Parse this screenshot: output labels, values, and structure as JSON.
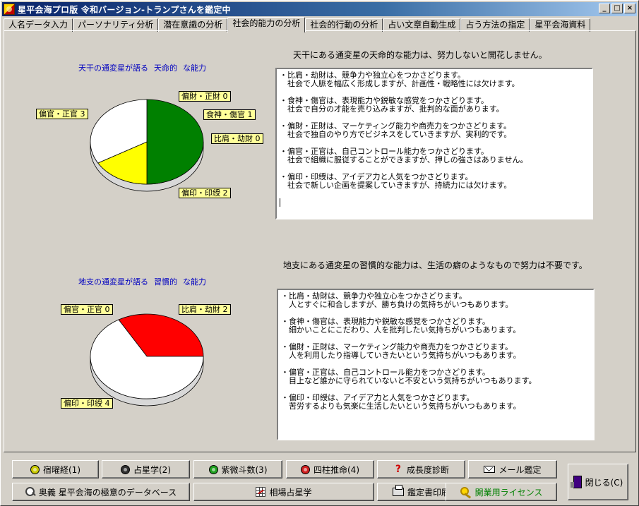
{
  "window": {
    "title": "星平会海プロ版 令和バージョン-トランプさんを鑑定中",
    "controls": {
      "minimize": "_",
      "maximize": "□",
      "close": "×"
    }
  },
  "tabs": [
    {
      "label": "人名データ入力"
    },
    {
      "label": "パーソナリティ分析"
    },
    {
      "label": "潜在意識の分析"
    },
    {
      "label": "社会的能力の分析",
      "active": true
    },
    {
      "label": "社会的行動の分析"
    },
    {
      "label": "占い文章自動生成"
    },
    {
      "label": "占う方法の指定"
    },
    {
      "label": "星平会海資料"
    }
  ],
  "top_section": {
    "heading": "天干にある通変星の天命的な能力は、努力しないと開花しません。",
    "chart_title": [
      "天干の通変星が語る",
      "天命的",
      "な能力"
    ],
    "pie_labels": {
      "henkan_seikan": "偏官・正官 3",
      "hensai_seizai": "偏財・正財 0",
      "shokujin_shokan": "食神・傷官 1",
      "hiken_kouzai": "比肩・劫財 0",
      "henin_inju": "偏印・印綬 2"
    },
    "text_lines": [
      [
        "・比肩・劫財は、競争力や独立心をつかさどります。",
        "　社会で人脈を幅広く形成しますが、計画性・戦略性には欠けます。"
      ],
      [
        "・食神・傷官は、表現能力や鋭敏な感覚をつかさどります。",
        "　社会で自分の才能を売り込みますが、批判的な面があります。"
      ],
      [
        "・偏財・正財は、マーケティング能力や商売力をつかさどります。",
        "　社会で独自のやり方でビジネスをしていきますが、実利的です。"
      ],
      [
        "・偏官・正官は、自己コントロール能力をつかさどります。",
        "　社会で組織に服従することができますが、押しの強さはありません。"
      ],
      [
        "・偏印・印綬は、アイデア力と人気をつかさどります。",
        "　社会で新しい企画を提案していきますが、持続力には欠けます。"
      ]
    ]
  },
  "bottom_section": {
    "heading": "地支にある通変星の習慣的な能力は、生活の癖のようなもので努力は不要です。",
    "chart_title": [
      "地支の通変星が語る",
      "習慣的",
      "な能力"
    ],
    "pie_labels": {
      "henkan_seikan": "偏官・正官 0",
      "hiken_kouzai": "比肩・劫財 2",
      "henin_inju": "偏印・印綬 4"
    },
    "text_lines": [
      [
        "・比肩・劫財は、競争力や独立心をつかさどります。",
        "　人とすぐに和合しますが、勝ち負けの気持ちがいつもあります。"
      ],
      [
        "・食神・傷官は、表現能力や鋭敏な感覚をつかさどります。",
        "　細かいことにこだわり、人を批判したい気持ちがいつもあります。"
      ],
      [
        "・偏財・正財は、マーケティング能力や商売力をつかさどります。",
        "　人を利用したり指導していきたいという気持ちがいつもあります。"
      ],
      [
        "・偏官・正官は、自己コントロール能力をつかさどります。",
        "　目上など誰かに守られていないと不安という気持ちがいつもあります。"
      ],
      [
        "・偏印・印綬は、アイデア力と人気をつかさどります。",
        "　苦労するよりも気楽に生活したいという気持ちがいつもあります。"
      ]
    ]
  },
  "chart_data": [
    {
      "type": "pie",
      "title": "天干の通変星が語る 天命的 な能力",
      "categories": [
        "偏官・正官",
        "食神・傷官",
        "偏印・印綬",
        "偏財・正財",
        "比肩・劫財"
      ],
      "values": [
        3,
        1,
        2,
        0,
        0
      ],
      "colors": [
        "#008000",
        "#ffff00",
        "#ffffff",
        "#ffffff",
        "#ffffff"
      ]
    },
    {
      "type": "pie",
      "title": "地支の通変星が語る 習慣的 な能力",
      "categories": [
        "比肩・劫財",
        "偏印・印綬",
        "偏官・正官"
      ],
      "values": [
        2,
        4,
        0
      ],
      "colors": [
        "#ff0000",
        "#ffffff",
        "#ffffff"
      ]
    }
  ],
  "buttons": {
    "row1": [
      {
        "label": "宿曜経(1)",
        "icon": "yellow-circle-icon",
        "color": "#c8c800"
      },
      {
        "label": "占星学(2)",
        "icon": "black-circle-icon",
        "color": "#303030"
      },
      {
        "label": "紫微斗数(3)",
        "icon": "green-circle-icon",
        "color": "#20a020"
      },
      {
        "label": "四柱推命(4)",
        "icon": "red-circle-icon",
        "color": "#d02020"
      },
      {
        "label": "成長度診断",
        "icon": "question-icon"
      },
      {
        "label": "メール鑑定",
        "icon": "envelope-icon"
      }
    ],
    "row2": [
      {
        "label": "奥義 星平会海の極意のデータベース",
        "icon": "magnifier-icon"
      },
      {
        "label": "相場占星学",
        "icon": "chart-grid-icon"
      },
      {
        "label": "鑑定書印刷",
        "icon": "printer-icon"
      },
      {
        "label": "開業用ライセンス",
        "icon": "key-icon"
      }
    ],
    "close": {
      "label": "閉じる(C)",
      "icon": "door-exit-icon"
    }
  }
}
